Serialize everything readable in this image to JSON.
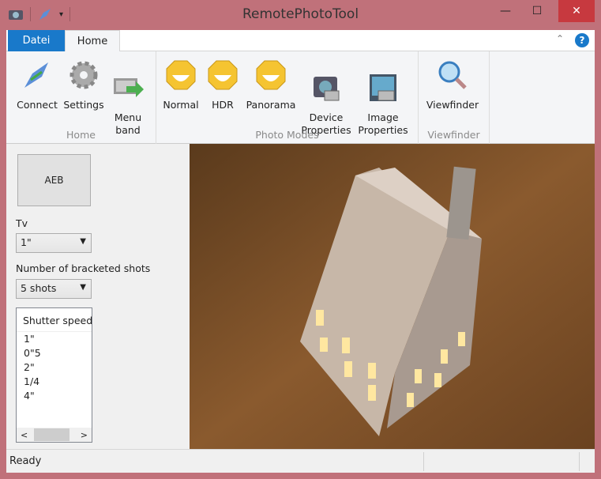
{
  "window": {
    "title": "RemotePhotoTool",
    "minimize": "—",
    "maximize": "☐",
    "close": "✕"
  },
  "ribbon": {
    "tabs": [
      {
        "label": "Datei"
      },
      {
        "label": "Home"
      }
    ],
    "groups": [
      {
        "label": "Home",
        "buttons": [
          {
            "label": "Connect",
            "icon": "connect-icon"
          },
          {
            "label": "Settings",
            "icon": "gear-icon"
          },
          {
            "label": "Menu\nband",
            "icon": "menu-band-icon"
          }
        ]
      },
      {
        "label": "Photo Modes",
        "buttons": [
          {
            "label": "Normal",
            "icon": "smiley-icon"
          },
          {
            "label": "HDR",
            "icon": "smiley-icon"
          },
          {
            "label": "Panorama",
            "icon": "smiley-icon"
          },
          {
            "label": "Device\nProperties",
            "icon": "device-properties-icon"
          },
          {
            "label": "Image\nProperties",
            "icon": "image-properties-icon"
          }
        ]
      },
      {
        "label": "Viewfinder",
        "buttons": [
          {
            "label": "Viewfinder",
            "icon": "magnifier-icon"
          }
        ]
      }
    ]
  },
  "panel": {
    "aeb_label": "AEB",
    "tv_label": "Tv",
    "tv_value": "1\"",
    "shots_label": "Number of bracketed shots",
    "shots_value": "5 shots",
    "list_header": "Shutter speed",
    "list_items": [
      "1\"",
      "0\"5",
      "2\"",
      "1/4",
      "4\""
    ]
  },
  "status": {
    "text": "Ready"
  },
  "colors": {
    "frame": "#c0717a",
    "file_tab": "#1979ca",
    "close": "#c7393f"
  }
}
